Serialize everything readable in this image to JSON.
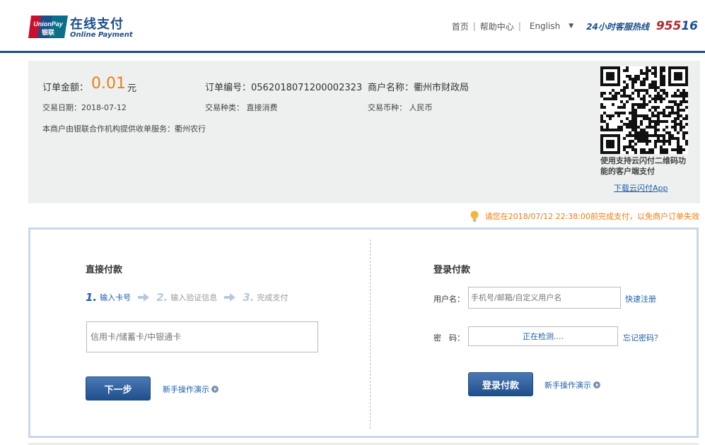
{
  "brand": {
    "logo_text": "UnionPay 银联",
    "name_cn": "在线支付",
    "name_en": "Online Payment",
    "colors": {
      "navy": "#1c4e8a",
      "red": "#c8102e",
      "teal": "#0b6e8a",
      "orange": "#f07c10"
    }
  },
  "topnav": {
    "home": "首页",
    "help": "帮助中心",
    "language": "English",
    "hotline_label": "24小时客服热线",
    "hotline_number_a": "955",
    "hotline_number_b": "16"
  },
  "order": {
    "amount_label": "订单金额：",
    "amount": "0.01",
    "amount_unit": "元",
    "order_no": "订单编号：0562018071200002323",
    "merchant": "商户名称：衢州市财政局",
    "date": "交易日期：2018-07-12",
    "type": "交易种类： 直接消费",
    "currency": "交易币种： 人民币",
    "service": "本商户由银联合作机构提供收单服务：衢州农行"
  },
  "qr": {
    "note": "使用支持云闪付二维码功能的客户端支付",
    "download": "下载云闪付App"
  },
  "warning": "请您在2018/07/12 22:38:00前完成支付，以免商户订单失效",
  "direct": {
    "title": "直接付款",
    "steps": [
      {
        "num": "1.",
        "label": "输入卡号"
      },
      {
        "num": "2.",
        "label": "输入验证信息"
      },
      {
        "num": "3.",
        "label": "完成支付"
      }
    ],
    "card_placeholder": "信用卡/储蓄卡/中银通卡",
    "next_button": "下一步",
    "demo_link": "新手操作演示"
  },
  "login": {
    "title": "登录付款",
    "username_label": "用户名：",
    "username_placeholder": "手机号/邮箱/自定义用户名",
    "register_link": "快速注册",
    "password_label": "密　码：",
    "password_value": "正在检测....",
    "forgot_link": "忘记密码？",
    "login_button": "登录付款",
    "demo_link": "新手操作演示"
  }
}
